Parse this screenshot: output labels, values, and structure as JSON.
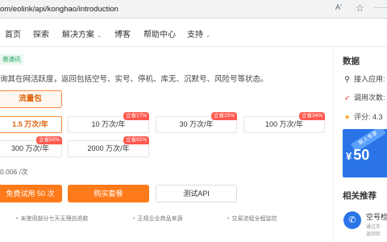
{
  "browser": {
    "url": "om/eolink/api/konghao/introduction",
    "reader_mode_label": "A",
    "icons": [
      "reader-mode-icon",
      "star-icon"
    ]
  },
  "nav": {
    "items": [
      {
        "label": "首页",
        "has_dropdown": false
      },
      {
        "label": "探索",
        "has_dropdown": false
      },
      {
        "label": "解决方案",
        "has_dropdown": true
      },
      {
        "label": "博客",
        "has_dropdown": false
      },
      {
        "label": "帮助中心",
        "has_dropdown": false
      },
      {
        "label": "支持",
        "has_dropdown": true
      }
    ],
    "dropdown_glyph": "⌄"
  },
  "product": {
    "tag": "易通讯",
    "description": "询其在网活跃度，返回包括空号、实号、停机、库无、沉默号、风险号等状态。",
    "package_label": "流量包",
    "options": [
      {
        "label": "1.5 万次/年",
        "badge": "",
        "selected": true
      },
      {
        "label": "10 万次/年",
        "badge": "立省17%",
        "selected": false
      },
      {
        "label": "30 万次/年",
        "badge": "立省25%",
        "selected": false
      },
      {
        "label": "100 万次/年",
        "badge": "立省34%",
        "selected": false
      },
      {
        "label": "300 万次/年",
        "badge": "立省50%",
        "selected": false
      },
      {
        "label": "2000 万次/年",
        "badge": "立省92%",
        "selected": false
      }
    ],
    "unit_price": "0.006 /次",
    "buttons": {
      "free_trial": "免费试用 50 次",
      "buy": "购买套餐",
      "test_api": "测试API"
    },
    "perks": [
      "未使用部分七天无理由退款",
      "正规企业商品来源",
      "交易流程全程监控"
    ]
  },
  "sidebar": {
    "title": "数据",
    "rows": [
      {
        "icon": "link-icon",
        "label": "接入应用:"
      },
      {
        "icon": "rocket-icon",
        "label": "调用次数:"
      },
      {
        "icon": "star-icon",
        "label": "评分:  4.3"
      }
    ],
    "price_card": {
      "ribbon": "新人专享",
      "currency": "¥",
      "price": "50"
    },
    "recommend_title": "相关推荐",
    "recommend": {
      "name": "空号检",
      "sub1": "通过手",
      "sub2": "返回检"
    }
  },
  "colors": {
    "accent": "#ff7a1a",
    "brand_blue": "#2a74e8",
    "badge_red": "#ff5a4f",
    "tag_green": "#22a560"
  }
}
